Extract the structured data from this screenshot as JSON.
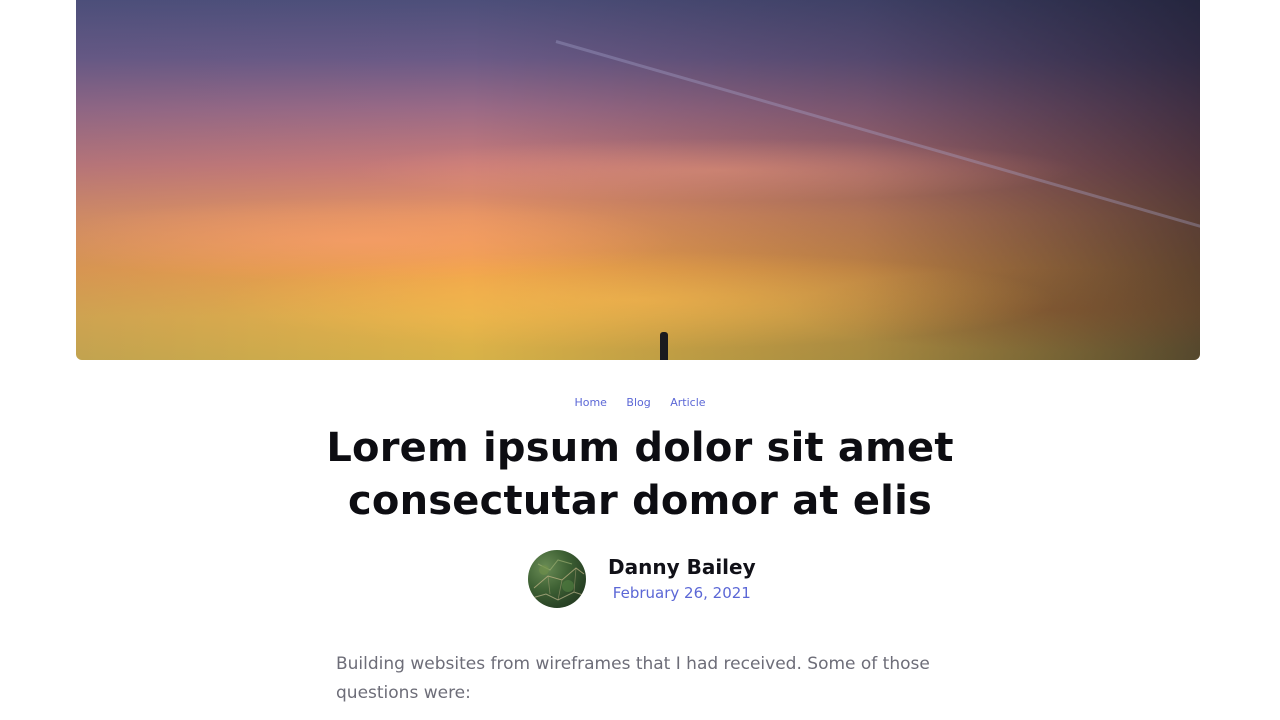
{
  "hero": {
    "image_name": "sunset-sky-image"
  },
  "breadcrumb": {
    "items": [
      "Home",
      "Blog",
      "Article"
    ]
  },
  "article": {
    "title": "Lorem ipsum dolor sit amet consectutar domor at elis",
    "author": {
      "name": "Danny Bailey",
      "date": "February 26, 2021",
      "avatar_icon": "avatar-icon"
    },
    "body": "Building websites from wireframes that I had received. Some of those questions were:"
  },
  "colors": {
    "accent": "#5b67d6",
    "title": "#0d0d12",
    "body_text": "#6d6d78"
  }
}
